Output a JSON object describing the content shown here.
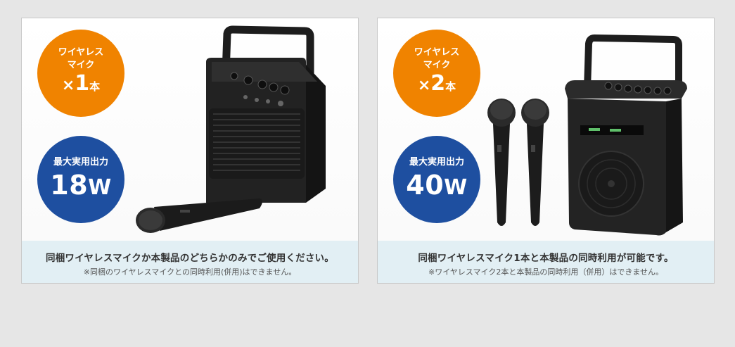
{
  "left": {
    "mic_badge": {
      "line1": "ワイヤレス",
      "line2": "マイク",
      "times": "×",
      "count": "1",
      "unit": "本"
    },
    "power_badge": {
      "label": "最大実用出力",
      "value": "18",
      "unit": "W"
    },
    "caption": "同梱ワイヤレスマイクか本製品のどちらかのみでご使用ください。",
    "note": "※同梱のワイヤレスマイクとの同時利用(併用)はできません。"
  },
  "right": {
    "mic_badge": {
      "line1": "ワイヤレス",
      "line2": "マイク",
      "times": "×",
      "count": "2",
      "unit": "本"
    },
    "power_badge": {
      "label": "最大実用出力",
      "value": "40",
      "unit": "W"
    },
    "caption": "同梱ワイヤレスマイク1本と本製品の同時利用が可能です。",
    "note": "※ワイヤレスマイク2本と本製品の同時利用（併用）はできません。"
  },
  "colors": {
    "badge_orange": "#f08300",
    "badge_blue": "#1e4fa0",
    "caption_bg": "#e2eff4",
    "page_bg": "#e6e6e6"
  }
}
